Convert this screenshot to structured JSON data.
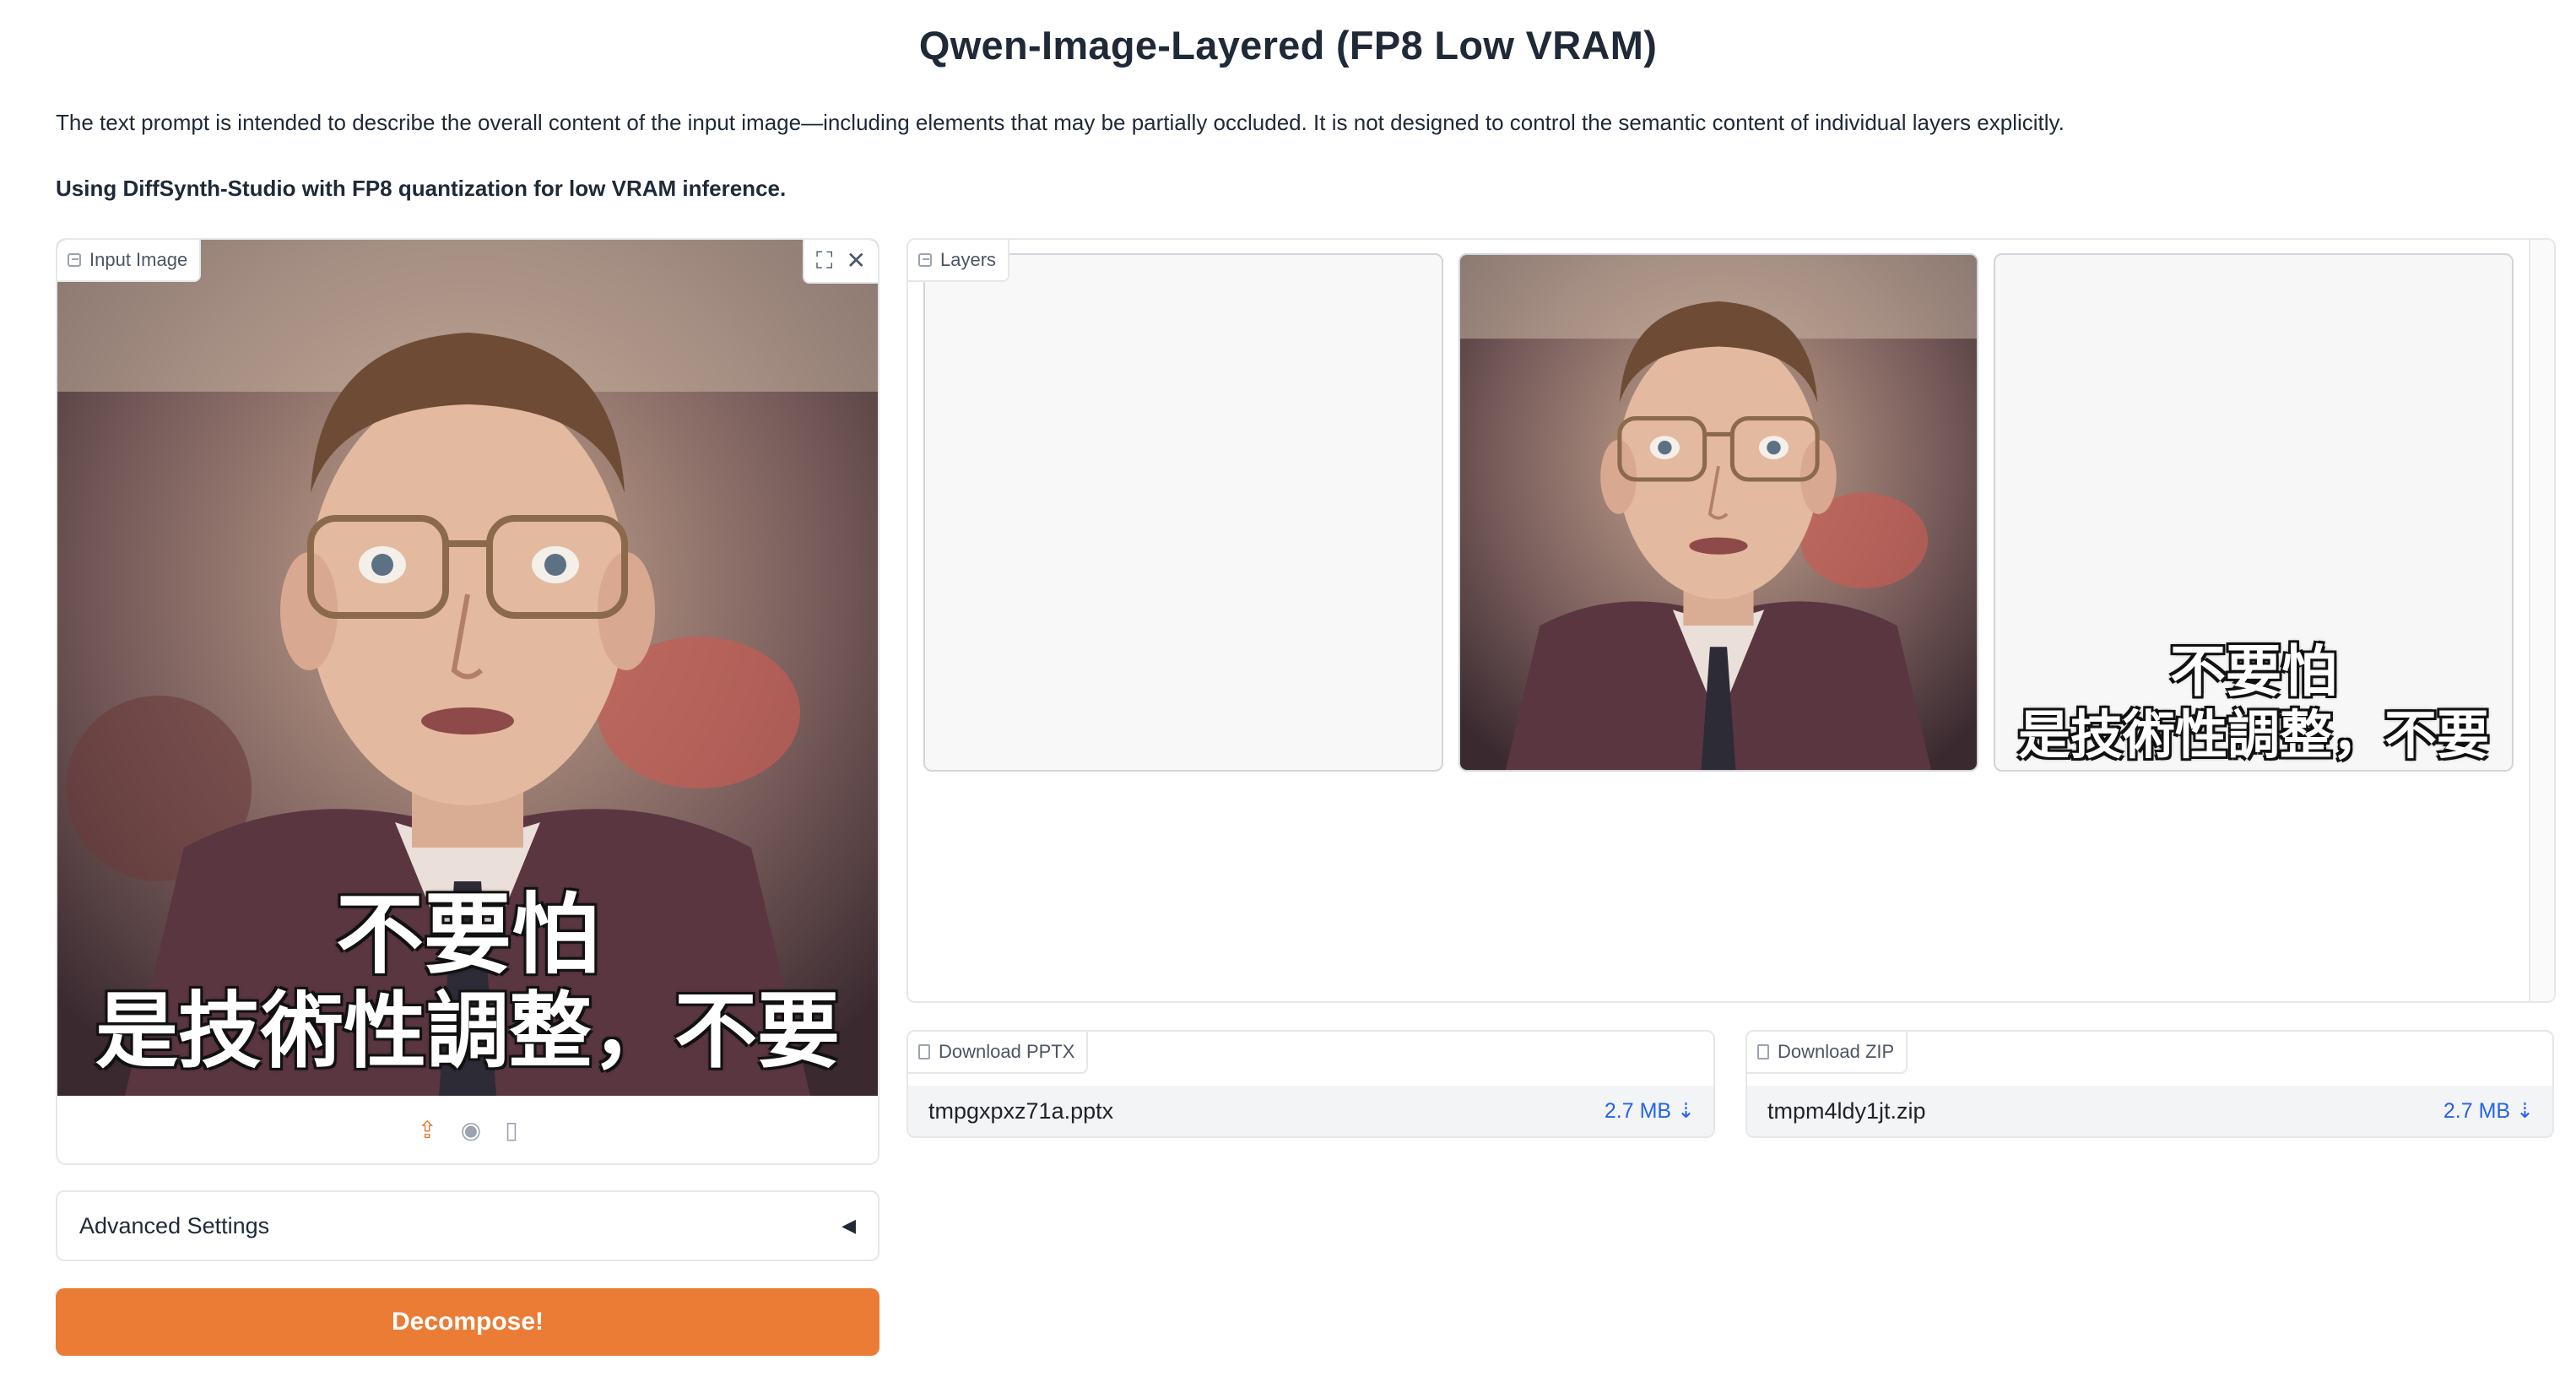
{
  "page": {
    "title": "Qwen-Image-Layered (FP8 Low VRAM)",
    "description": "The text prompt is intended to describe the overall content of the input image—including elements that may be partially occluded. It is not designed to control the semantic content of individual layers explicitly.",
    "note": "Using DiffSynth-Studio with FP8 quantization for low VRAM inference."
  },
  "input_image": {
    "label": "Input Image",
    "caption_line1": "不要怕",
    "caption_line2": "是技術性調整，不要怕",
    "source_icons": [
      "upload-icon",
      "webcam-icon",
      "clipboard-icon"
    ]
  },
  "advanced": {
    "label": "Advanced Settings",
    "caret": "◀"
  },
  "decompose_button": "Decompose!",
  "layers": {
    "label": "Layers",
    "items": [
      {
        "name": "empty-layer"
      },
      {
        "name": "person-layer"
      },
      {
        "name": "text-layer",
        "caption_line1": "不要怕",
        "caption_line2": "是技術性調整，不要怕"
      }
    ]
  },
  "downloads": [
    {
      "label": "Download PPTX",
      "file": "tmpgxpxz71a.pptx",
      "size": "2.7 MB ⇣"
    },
    {
      "label": "Download ZIP",
      "file": "tmpm4ldy1jt.zip",
      "size": "2.7 MB ⇣"
    }
  ],
  "colors": {
    "accent": "#ea7c36",
    "link": "#2563eb",
    "border": "#e5e7eb"
  }
}
